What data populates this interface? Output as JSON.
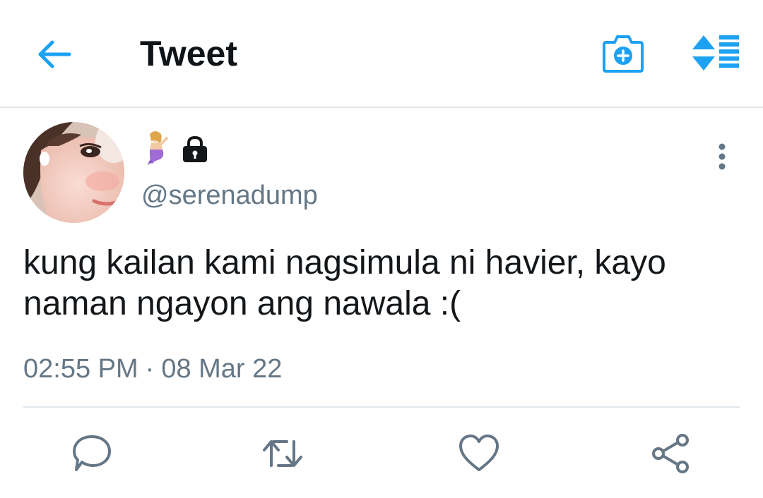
{
  "header": {
    "title": "Tweet",
    "back_icon": "arrow-left-icon",
    "camera_icon": "camera-plus-icon",
    "sort_icon": "sort-list-icon",
    "accent_color": "#1da1f2"
  },
  "tweet": {
    "avatar_icon": "profile-photo",
    "display_name_icons": [
      "mermaid-emoji",
      "lock-icon"
    ],
    "handle": "@serenadump",
    "text": "kung kailan kami nagsimula ni havier, kayo naman ngayon ang nawala :(",
    "time": "02:55 PM",
    "separator": "·",
    "date": "08 Mar 22",
    "more_icon": "more-vertical-icon"
  },
  "actions": [
    {
      "name": "reply",
      "icon": "reply-icon"
    },
    {
      "name": "retweet",
      "icon": "retweet-icon"
    },
    {
      "name": "like",
      "icon": "heart-icon"
    },
    {
      "name": "share",
      "icon": "share-icon"
    }
  ],
  "colors": {
    "text_primary": "#14171a",
    "text_secondary": "#657786",
    "divider": "#e1e8ed",
    "icon_gray": "#657786"
  }
}
